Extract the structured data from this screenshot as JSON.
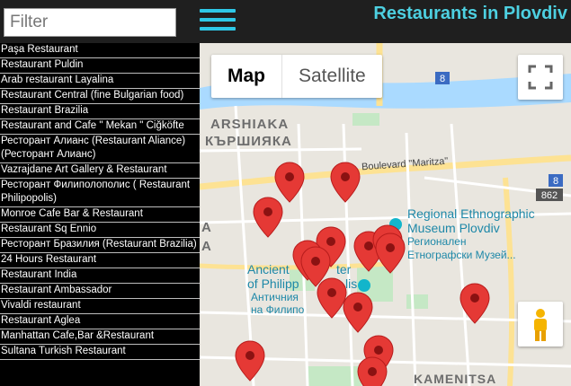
{
  "header": {
    "filter_placeholder": "Filter",
    "title": "Restaurants in Plovdiv"
  },
  "restaurants": [
    "Paşa Restaurant",
    "Restaurant Puldin",
    "Arab restaurant Layalina",
    "Restaurant Central (fine Bulgarian food)",
    "Restaurant Brazilia",
    "Restaurant and Cafe \" Mekan \" Ciğköfte",
    "Ресторант Алианс (Restaurant Aliance) (Ресторант Алианс)",
    "Vazrajdane Art Gallery & Restaurant",
    "Ресторант Филиполополис ( Restaurant Philipopolis)",
    "Monroe Cafe Bar & Restaurant",
    "Restaurant Sq Ennio",
    "Ресторант Бразилия (Restaurant Brazilia)",
    "24 Hours Restaurant",
    "Restaurant India",
    "Restaurant Ambassador",
    "Vivaldi restaurant",
    "Restaurant Aglea",
    "Manhattan Cafe,Bar &Restaurant",
    "Sultana Turkish Restaurant"
  ],
  "map": {
    "type_map": "Map",
    "type_satellite": "Satellite",
    "labels": {
      "district_latin": "ARSHIAKA",
      "district_cyrillic": "КЪРШИЯКА",
      "boulevard": "Boulevard \"Maritza\"",
      "museum_en_1": "Regional Ethnographic",
      "museum_en_2": "Museum Plovdiv",
      "museum_bg_1": "Регионален",
      "museum_bg_2": "Етнографски Музей...",
      "ancient_1": "Ancient",
      "ancient_1b": "ter",
      "ancient_2": "of Philipp",
      "ancient_2b": "lis",
      "ancient_bg_1": "Античния",
      "ancient_bg_2": "на Филипо",
      "road_8_top": "8",
      "road_8_mid": "8",
      "road_862": "862",
      "edge_a1": "A",
      "edge_a2": "A",
      "kamenitsa": "KAMENITSA"
    },
    "colors": {
      "marker": "#e53935",
      "water": "#aadaff",
      "park": "#c5e8c5",
      "road_major": "#fde293"
    }
  }
}
